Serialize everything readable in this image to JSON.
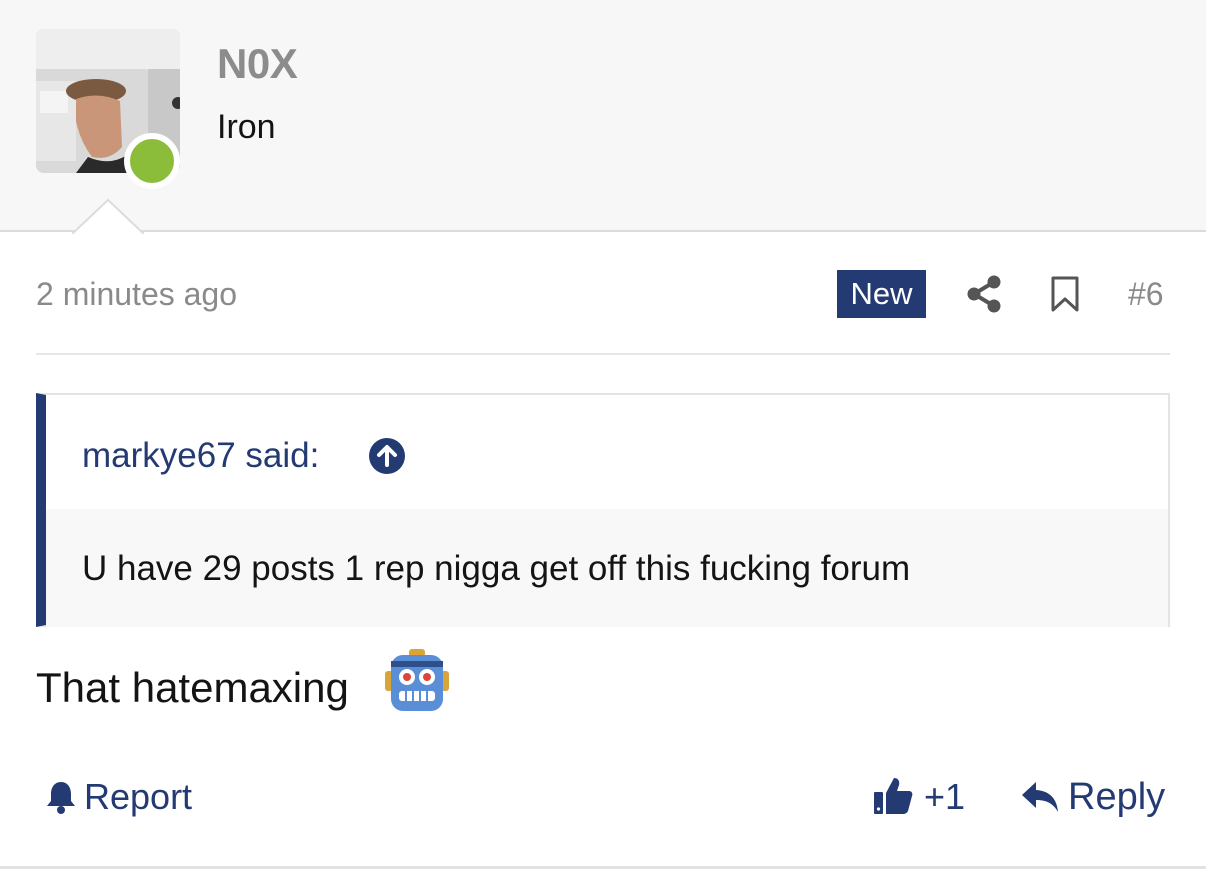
{
  "user": {
    "username": "N0X",
    "title": "Iron",
    "status": "online"
  },
  "post": {
    "timestamp": "2 minutes ago",
    "badge": "New",
    "number": "#6",
    "quote": {
      "author_line": "markye67 said:",
      "text": "U have 29 posts 1 rep nigga get off this fucking forum"
    },
    "message": "That hatemaxing",
    "message_emoji": "robot-face-icon"
  },
  "actions": {
    "report_label": "Report",
    "like_count": "+1",
    "reply_label": "Reply"
  },
  "colors": {
    "accent": "#243a73",
    "online": "#8bbd3a",
    "header_bg": "#f7f7f7",
    "muted_text": "#8a8a8a"
  },
  "icons": [
    "share-icon",
    "bookmark-icon",
    "arrow-up-circle-icon",
    "bell-icon",
    "thumbs-up-icon",
    "reply-arrow-icon",
    "robot-face-icon"
  ]
}
